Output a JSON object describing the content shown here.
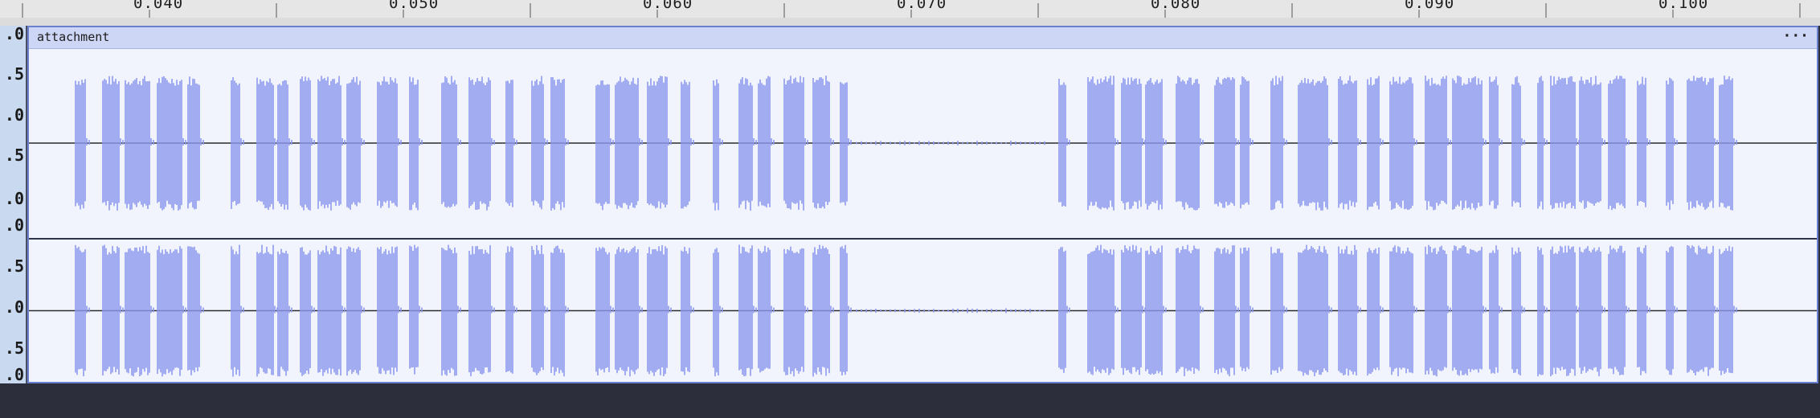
{
  "ruler": {
    "ticks": [
      "0.040",
      "0.050",
      "0.060",
      "0.070",
      "0.080",
      "0.090",
      "0.100"
    ]
  },
  "track": {
    "clip_name": "attachment",
    "menu_icon": "ellipsis-icon",
    "menu_glyph": "···",
    "waveform_color": "#8e99ee",
    "centerline_color": "#2b2b2b"
  },
  "channel1": {
    "scale_labels": [
      "0",
      ".0",
      ".5",
      ".0",
      ".5",
      ".0"
    ]
  },
  "channel2": {
    "scale_labels": [
      ".0",
      ".5",
      ".0",
      ".5",
      ".0"
    ]
  }
}
